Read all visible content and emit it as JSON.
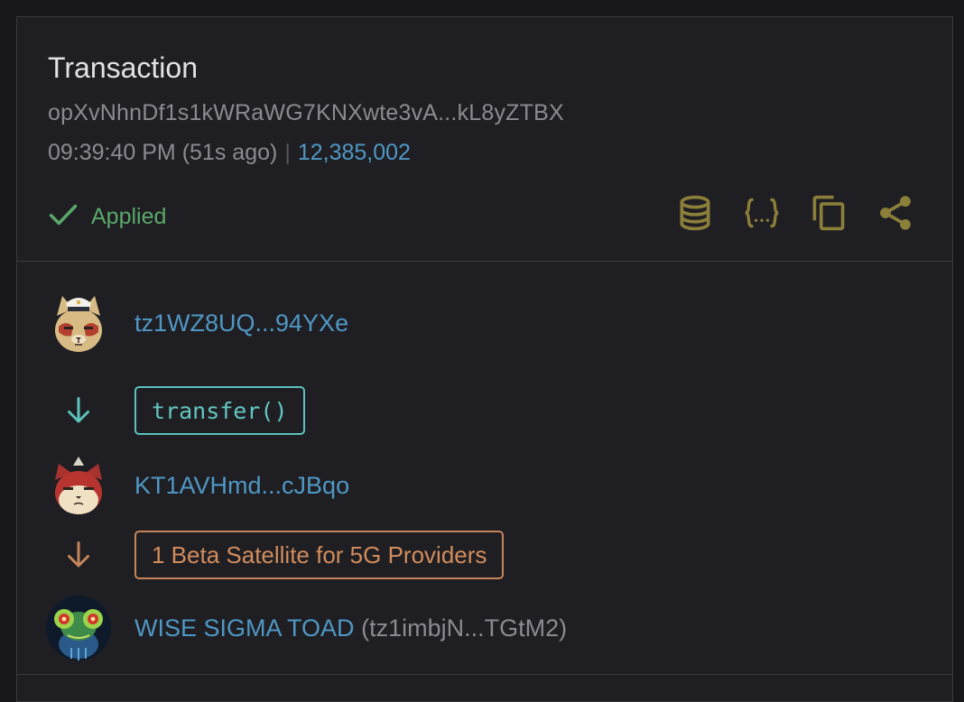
{
  "header": {
    "title": "Transaction",
    "op_hash": "opXvNhnDf1s1kWRaWG7KNXwte3vA...kL8yZTBX",
    "time": "09:39:40 PM (51s ago)",
    "separator": "|",
    "block_level": "12,385,002"
  },
  "status": {
    "icon": "check-icon",
    "label": "Applied",
    "color": "#59a86a"
  },
  "toolbar": {
    "icons": [
      "database-icon",
      "json-braces-icon",
      "copy-icon",
      "share-icon"
    ],
    "color": "#8b7f3a"
  },
  "flow": {
    "sender": {
      "address": "tz1WZ8UQ...94YXe",
      "avatar": "cat-captain-avatar"
    },
    "entrypoint": {
      "label": "transfer()",
      "arrow_color": "#5cc2bc"
    },
    "contract": {
      "address": "KT1AVHmd...cJBqo",
      "avatar": "cat-red-avatar"
    },
    "token": {
      "label": "1 Beta Satellite for 5G Providers",
      "arrow_color": "#c5855a"
    },
    "receiver": {
      "name": "WISE SIGMA TOAD",
      "address": "(tz1imbjN...TGtM2)",
      "avatar": "toad-avatar"
    }
  },
  "colors": {
    "link": "#4f97c4",
    "muted": "#8a8a90",
    "background": "#1f1f23"
  }
}
